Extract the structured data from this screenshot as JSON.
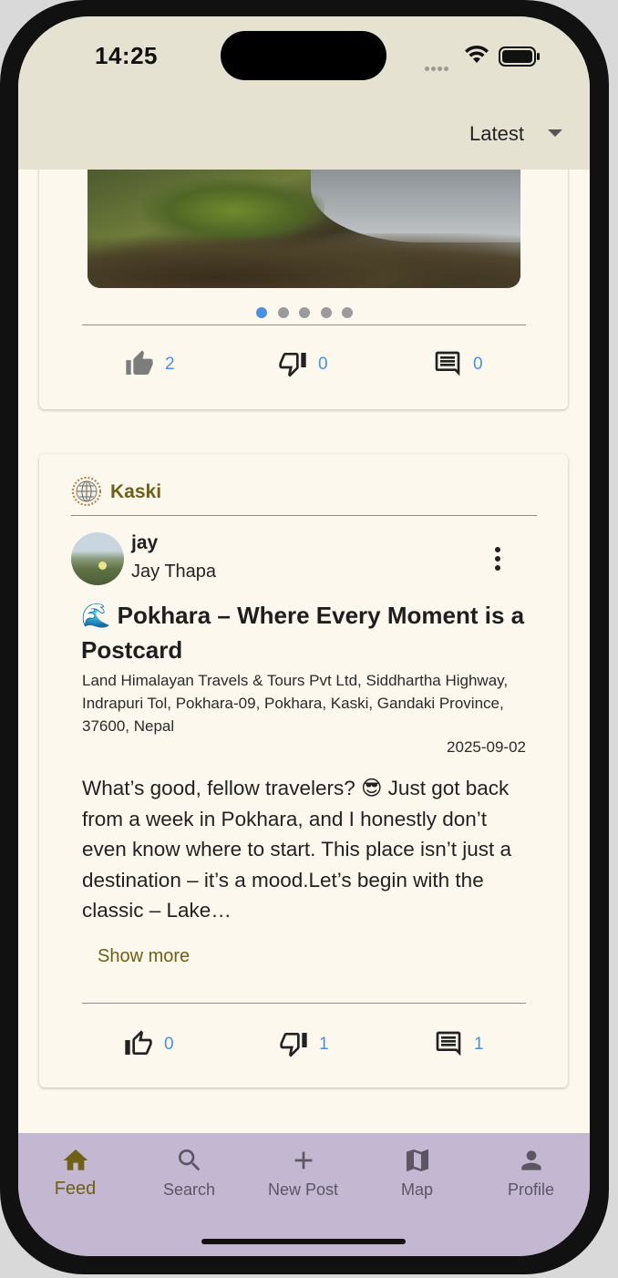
{
  "status_bar": {
    "time": "14:25"
  },
  "header": {
    "sort_label": "Latest"
  },
  "post_prev": {
    "carousel_count": 5,
    "carousel_active_index": 0,
    "likes": "2",
    "dislikes": "0",
    "comments": "0"
  },
  "post": {
    "region": "Kaski",
    "username": "jay",
    "full_name": "Jay Thapa",
    "title": "🌊 Pokhara – Where Every Moment is a Postcard",
    "address": "Land Himalayan Travels & Tours Pvt Ltd, Siddhartha Highway, Indrapuri Tol, Pokhara-09, Pokhara, Kaski, Gandaki Province, 37600, Nepal",
    "date": "2025-09-02",
    "body": "What’s good, fellow travelers? 😎  Just got back from a week in Pokhara, and I honestly don’t even know where to start. This place isn’t just a destination – it’s a mood.Let’s begin with the classic – Lake…",
    "show_more": "Show more",
    "likes": "0",
    "dislikes": "1",
    "comments": "1"
  },
  "nav": {
    "items": [
      {
        "label": "Feed",
        "icon": "home-icon"
      },
      {
        "label": "Search",
        "icon": "search-icon"
      },
      {
        "label": "New Post",
        "icon": "plus-icon"
      },
      {
        "label": "Map",
        "icon": "map-icon"
      },
      {
        "label": "Profile",
        "icon": "person-icon"
      }
    ],
    "active": "Feed"
  },
  "colors": {
    "accent_link": "#4a8fe0",
    "region_gold": "#6e6017",
    "nav_bg": "#c3b7d2",
    "header_bg": "#e6e2d2",
    "card_bg": "#fdf8ee"
  }
}
